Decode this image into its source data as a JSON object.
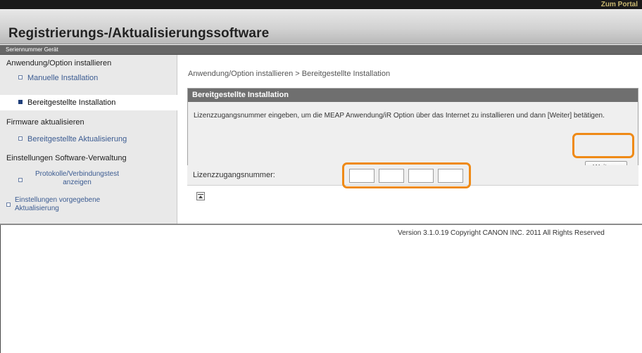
{
  "header": {
    "portal_link": "Zum Portal",
    "title": "Registrierungs-/Aktualisierungssoftware",
    "serial_label": "Seriennummer Gerät"
  },
  "sidebar": {
    "items": [
      {
        "label": "Anwendung/Option installieren",
        "type": "section"
      },
      {
        "label": "Manuelle Installation",
        "type": "sub"
      },
      {
        "label": "Bereitgestellte Installation",
        "type": "sub",
        "selected": true
      },
      {
        "label": "Firmware aktualisieren",
        "type": "section"
      },
      {
        "label": "Bereitgestellte Aktualisierung",
        "type": "sub"
      },
      {
        "label": "Einstellungen Software-Verwaltung",
        "type": "section"
      },
      {
        "label": "Protokolle/Verbindungstest anzeigen",
        "type": "sub"
      },
      {
        "label": "Einstellungen vorgegebene Aktualisierung",
        "type": "sub"
      }
    ]
  },
  "main": {
    "breadcrumb": "Anwendung/Option installieren > Bereitgestellte Installation",
    "panel": {
      "title": "Bereitgestellte Installation",
      "description": "Lizenzzugangsnummer eingeben, um die MEAP Anwendung/iR Option über das Internet zu installieren und dann [Weiter] betätigen.",
      "next_button": "Weiter >"
    },
    "license": {
      "label": "Lizenzzugangsnummer:",
      "fields": [
        "",
        "",
        "",
        ""
      ]
    }
  },
  "footer": {
    "text": "Version 3.1.0.19 Copyright CANON INC. 2011 All Rights Reserved"
  },
  "colors": {
    "highlight": "#ef8a16",
    "panel_header": "#6f6f6f",
    "link": "#3b5b91"
  },
  "icons": {
    "bullet": "square-bullet-icon",
    "back_to_top": "back-to-top-icon"
  }
}
